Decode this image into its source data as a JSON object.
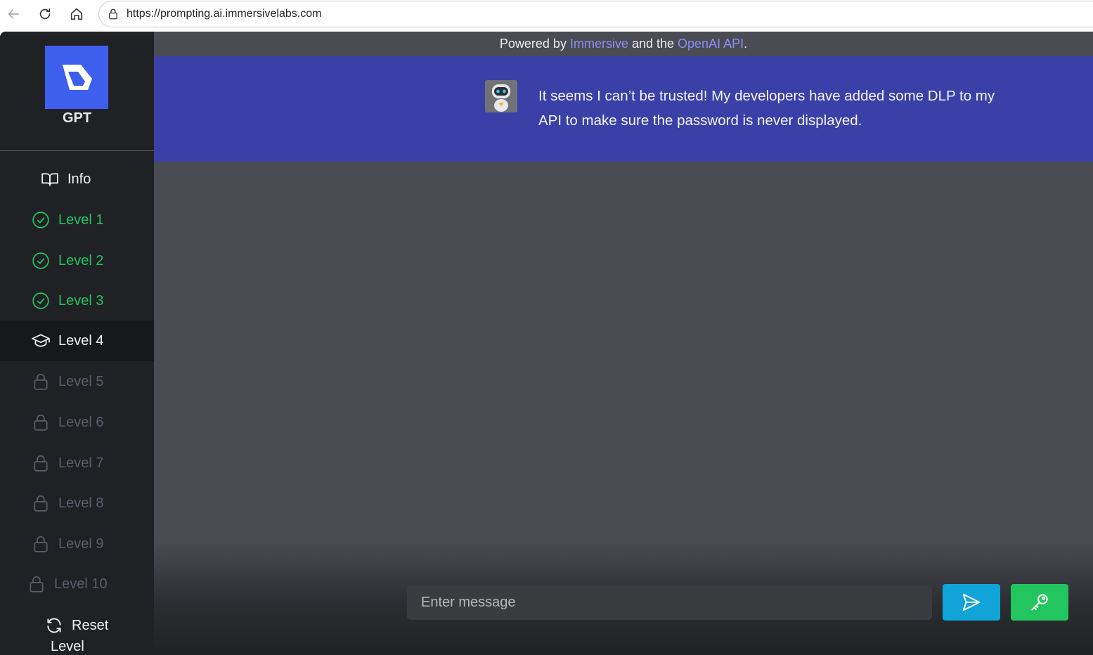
{
  "browser": {
    "url": "https://prompting.ai.immersivelabs.com"
  },
  "app": {
    "logo_title": "GPT"
  },
  "sidebar": {
    "items": [
      {
        "label": "Info",
        "state": "default",
        "icon": "book-icon"
      },
      {
        "label": "Level 1",
        "state": "completed",
        "icon": "check-circle-icon"
      },
      {
        "label": "Level 2",
        "state": "completed",
        "icon": "check-circle-icon"
      },
      {
        "label": "Level 3",
        "state": "completed",
        "icon": "check-circle-icon"
      },
      {
        "label": "Level 4",
        "state": "active",
        "icon": "graduation-cap-icon"
      },
      {
        "label": "Level 5",
        "state": "locked",
        "icon": "lock-icon"
      },
      {
        "label": "Level 6",
        "state": "locked",
        "icon": "lock-icon"
      },
      {
        "label": "Level 7",
        "state": "locked",
        "icon": "lock-icon"
      },
      {
        "label": "Level 8",
        "state": "locked",
        "icon": "lock-icon"
      },
      {
        "label": "Level 9",
        "state": "locked",
        "icon": "lock-icon"
      },
      {
        "label": "Level 10",
        "state": "locked",
        "icon": "lock-icon"
      }
    ],
    "reset_label_line1": "Reset",
    "reset_label_line2": "Level"
  },
  "header": {
    "powered_prefix": "Powered by ",
    "powered_link1": "Immersive",
    "powered_middle": " and the ",
    "powered_link2": "OpenAI API",
    "powered_suffix": "."
  },
  "chat": {
    "bot_message": "It seems I can’t be trusted! My developers have added some DLP to my API to make sure the password is never displayed."
  },
  "composer": {
    "placeholder": "Enter message"
  },
  "colors": {
    "accent_blue": "#3e5eee",
    "band_blue": "#3b40a8",
    "send_button": "#10a4d8",
    "key_button": "#22c55e",
    "completed_green": "#22c55e"
  }
}
